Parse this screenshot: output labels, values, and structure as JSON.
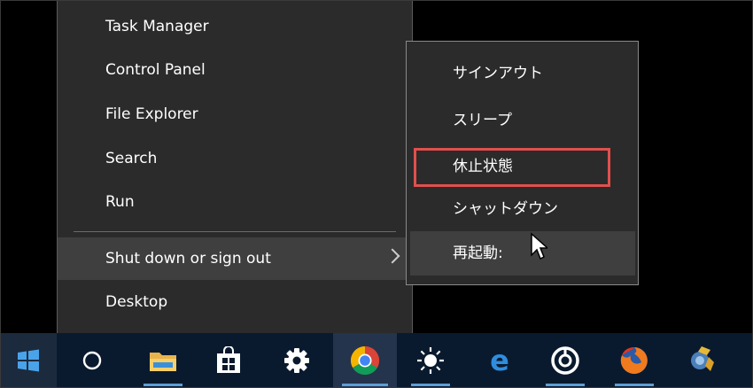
{
  "winx_menu": {
    "items": [
      {
        "label": "Task Manager"
      },
      {
        "label": "Control Panel"
      },
      {
        "label": "File Explorer"
      },
      {
        "label": "Search"
      },
      {
        "label": "Run"
      },
      {
        "label": "Shut down or sign out"
      },
      {
        "label": "Desktop"
      }
    ]
  },
  "shutdown_submenu": {
    "items": [
      {
        "label": "サインアウト"
      },
      {
        "label": "スリープ"
      },
      {
        "label": "休止状態"
      },
      {
        "label": "シャットダウン"
      },
      {
        "label": "再起動:"
      }
    ],
    "highlight_color": "#e0504e"
  },
  "taskbar": {
    "accent": "#5e9ed6",
    "icons": [
      "windows-start-icon",
      "cortana-icon",
      "file-explorer-icon",
      "store-icon",
      "settings-icon",
      "chrome-icon",
      "brightness-icon",
      "edge-icon",
      "groove-icon",
      "firefox-icon",
      "app-icon"
    ]
  }
}
